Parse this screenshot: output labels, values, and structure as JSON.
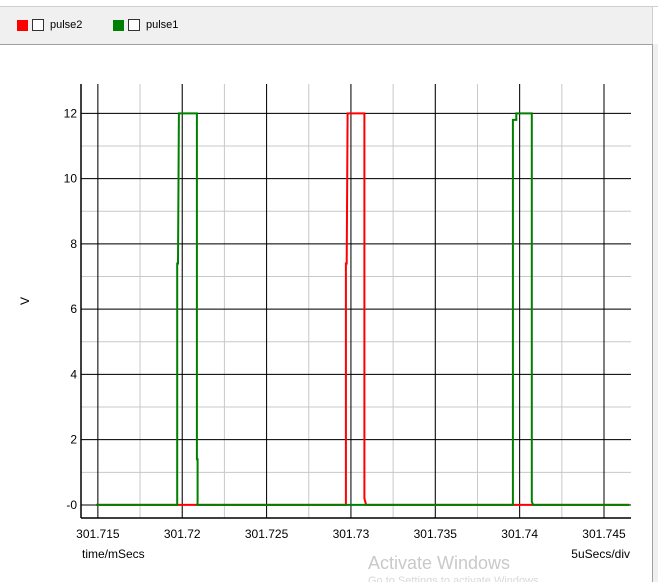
{
  "legend": [
    {
      "label": "pulse2",
      "color": "#ff0000"
    },
    {
      "label": "pulse1",
      "color": "#008000"
    }
  ],
  "footer": {
    "x_unit_label": "time/mSecs",
    "div_label": "5uSecs/div"
  },
  "watermark": {
    "line1": "Activate Windows",
    "line2": "Go to Settings to activate Windows."
  },
  "chart_data": {
    "type": "line",
    "xlabel": "",
    "ylabel": "V",
    "xlim": [
      301.714,
      301.7466
    ],
    "ylim": [
      -0.4,
      12.9
    ],
    "x_ticks": [
      "301.715",
      "301.72",
      "301.725",
      "301.73",
      "301.735",
      "301.74",
      "301.745"
    ],
    "x_tick_values": [
      301.715,
      301.72,
      301.725,
      301.73,
      301.735,
      301.74,
      301.745
    ],
    "y_ticks": [
      "0",
      "2",
      "4",
      "6",
      "8",
      "10",
      "12"
    ],
    "y_tick_values": [
      0,
      2,
      4,
      6,
      8,
      10,
      12
    ],
    "grid": true,
    "series": [
      {
        "name": "pulse2",
        "color": "#ff0000",
        "x": [
          301.7149,
          301.7297,
          301.7297,
          301.72975,
          301.7298,
          301.7308,
          301.7308,
          301.7309,
          301.7465
        ],
        "y": [
          0,
          0,
          7.4,
          7.4,
          12,
          12,
          0.2,
          0,
          0
        ]
      },
      {
        "name": "pulse1",
        "color": "#008000",
        "x": [
          301.7149,
          301.7197,
          301.7197,
          301.71975,
          301.7198,
          301.72087,
          301.72087,
          301.72091,
          301.72091,
          301.7209,
          301.7396,
          301.7396,
          301.7398,
          301.7398,
          301.74072,
          301.74072,
          301.7408,
          301.7465
        ],
        "y": [
          0,
          0,
          7.4,
          7.4,
          12,
          12,
          1.4,
          1.4,
          0.1,
          0,
          0,
          11.8,
          11.8,
          12,
          12,
          0.1,
          0,
          0
        ]
      }
    ]
  }
}
